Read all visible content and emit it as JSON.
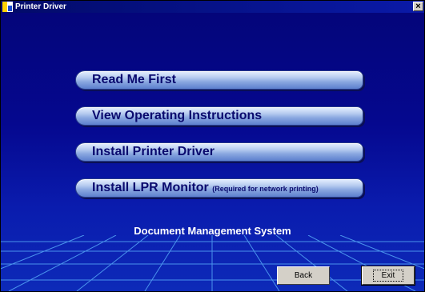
{
  "window": {
    "title": "Printer Driver",
    "close_glyph": "×"
  },
  "menu": {
    "read_me": "Read Me First",
    "view_instructions": "View Operating Instructions",
    "install_driver": "Install Printer Driver",
    "install_lpr": "Install LPR Monitor",
    "install_lpr_note": "(Required for network printing)"
  },
  "footer": {
    "title": "Document Management System",
    "back_label": "Back",
    "exit_label": "Exit"
  },
  "colors": {
    "background": "#05088f",
    "button_text": "#0a0a6e"
  }
}
